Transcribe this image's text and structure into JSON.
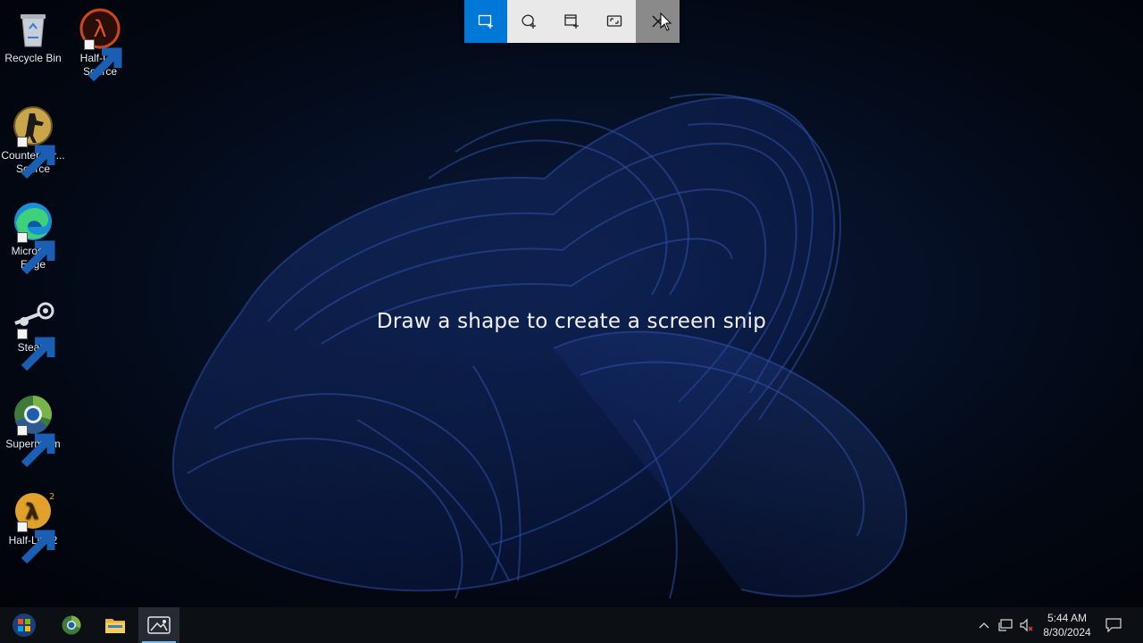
{
  "snip_toolbar": {
    "buttons": [
      {
        "icon": "rectangular-snip-icon",
        "tooltip": "Rectangular Snip",
        "active": true
      },
      {
        "icon": "freeform-snip-icon",
        "tooltip": "Freeform Snip"
      },
      {
        "icon": "window-snip-icon",
        "tooltip": "Window Snip"
      },
      {
        "icon": "fullscreen-snip-icon",
        "tooltip": "Fullscreen Snip"
      },
      {
        "icon": "close-icon",
        "tooltip": "Close Snipping"
      }
    ],
    "accent": "#0078d7"
  },
  "hint": "Draw a shape to create a screen snip",
  "desktop_icons": [
    {
      "label": "Recycle Bin",
      "icon": "recycle-bin-icon"
    },
    {
      "label": "Half-Life Source",
      "icon": "half-life-source-icon"
    },
    {
      "label": "Counter-Str... Source",
      "icon": "counter-strike-source-icon"
    },
    {
      "label": "Microsoft Edge",
      "icon": "microsoft-edge-icon"
    },
    {
      "label": "Steam",
      "icon": "steam-icon"
    },
    {
      "label": "Supermium",
      "icon": "supermium-icon"
    },
    {
      "label": "Half-Life 2",
      "icon": "half-life-2-icon"
    }
  ],
  "taskbar": {
    "apps": [
      {
        "name": "start",
        "icon": "windows-start-icon"
      },
      {
        "name": "supermium",
        "icon": "supermium-taskbar-icon"
      },
      {
        "name": "file-explorer",
        "icon": "file-explorer-icon"
      },
      {
        "name": "snipping-tool",
        "icon": "snipping-tool-icon",
        "active": true
      }
    ],
    "tray": {
      "icons": [
        "chevron-up-icon",
        "network-icon",
        "volume-muted-icon",
        "notifications-icon"
      ],
      "time": "5:44 AM",
      "date": "8/30/2024"
    }
  }
}
